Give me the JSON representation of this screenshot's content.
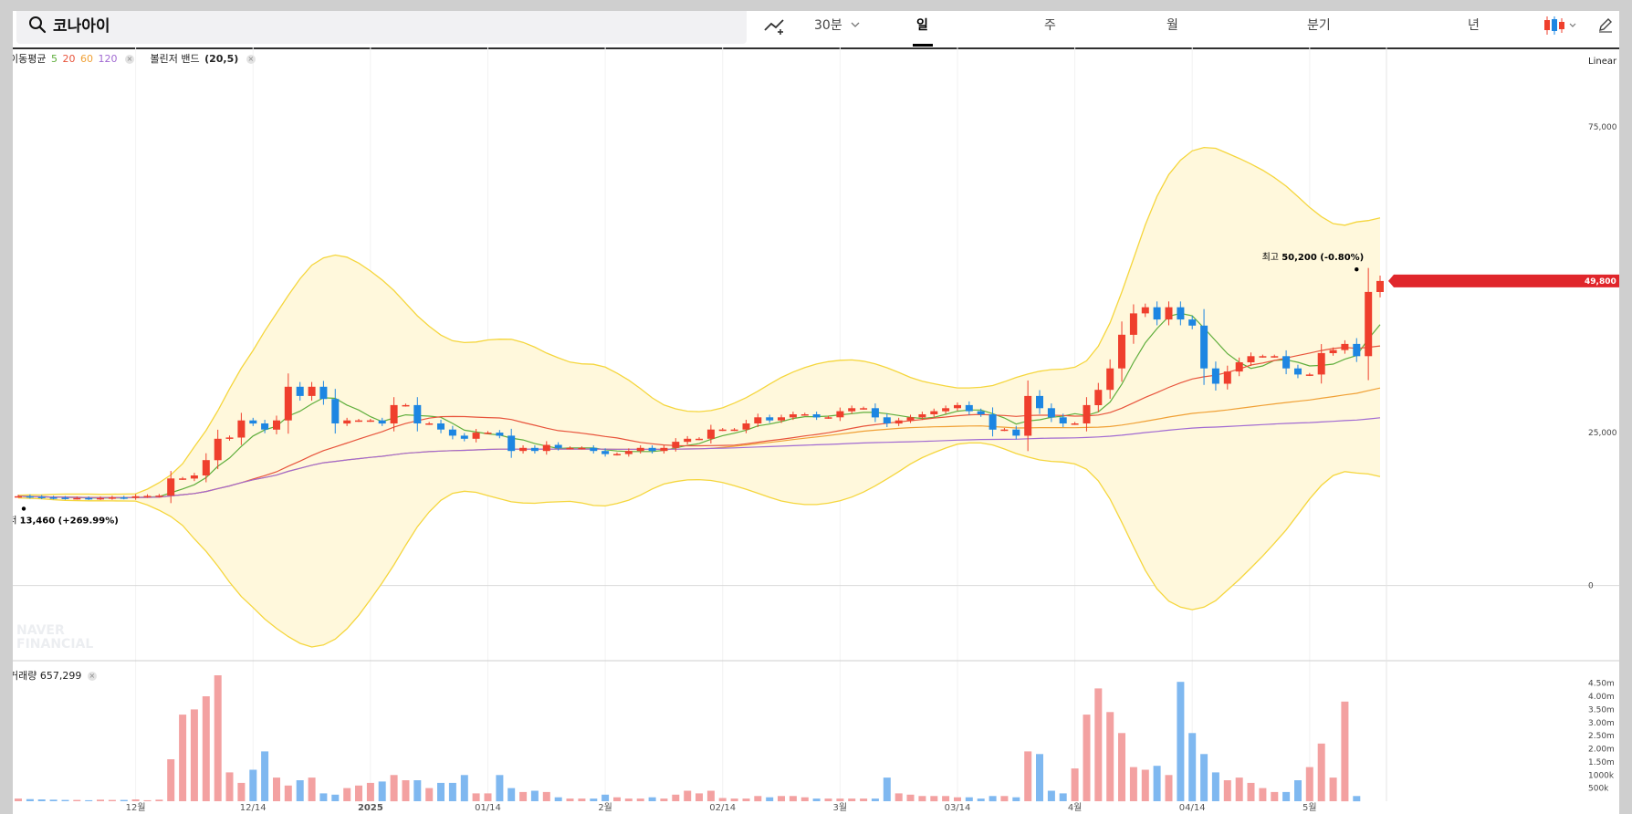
{
  "search": {
    "value": "코나아이",
    "icon": "search-icon"
  },
  "toolbar": {
    "draw_icon": "line-chart-plus-icon",
    "interval": "30분",
    "periods": [
      "일",
      "주",
      "월",
      "분기",
      "년"
    ],
    "active_period": "일",
    "candle_icon": "candlestick-icon",
    "edit_icon": "pencil-icon"
  },
  "indicators": {
    "ma_label": "이동평균",
    "ma_periods": [
      "5",
      "20",
      "60",
      "120"
    ],
    "ma_colors": [
      "#5fae3c",
      "#e8543c",
      "#f0a035",
      "#a16ad2"
    ],
    "bb_label": "볼린저 밴드",
    "bb_params": "(20,5)"
  },
  "scale_label": "Linear",
  "watermark": [
    "NAVER",
    "FINANCIAL"
  ],
  "volume_label": "거래량 657,299",
  "chart_data": {
    "type": "candlestick",
    "y_ticks": [
      "75,000",
      "25,000",
      "0"
    ],
    "y_tick_values": [
      75000,
      25000,
      0
    ],
    "ylim": [
      -12000,
      85000
    ],
    "volume_ticks": [
      "4.50m",
      "4.00m",
      "3.50m",
      "3.00m",
      "2.50m",
      "2.00m",
      "1.50m",
      "1000k",
      "500k"
    ],
    "volume_tick_values": [
      4500000,
      4000000,
      3500000,
      3000000,
      2500000,
      2000000,
      1500000,
      1000000,
      500000
    ],
    "volume_ylim": [
      0,
      4800000
    ],
    "x_labels": [
      "12월",
      "12/14",
      "2025",
      "01/14",
      "2월",
      "02/14",
      "3월",
      "03/14",
      "4월",
      "04/14",
      "5월"
    ],
    "x_label_index": [
      10,
      20,
      30,
      40,
      50,
      60,
      70,
      80,
      90,
      100,
      110
    ],
    "last_price_label": "49,800",
    "last_price": 49800,
    "high_annotation": {
      "prefix": "최고",
      "value": "50,200 (-0.80%)",
      "index": 114,
      "price": 50200
    },
    "low_annotation": {
      "prefix": "최저",
      "value": "13,460 (+269.99%)",
      "index": 0,
      "price": 13460
    },
    "colors": {
      "up": "#ef3f2d",
      "down": "#1d86e2",
      "up_volume": "#f3a1a1",
      "down_volume": "#7fb8f0",
      "band_fill": "#fff8dc",
      "band_line": "#f5d63d"
    },
    "close": [
      14600,
      14500,
      14400,
      14350,
      14300,
      14300,
      14250,
      14300,
      14400,
      14350,
      14600,
      14650,
      14700,
      17500,
      17500,
      18000,
      20500,
      24000,
      24200,
      27000,
      26500,
      25500,
      27000,
      32500,
      31000,
      32500,
      30500,
      26500,
      27000,
      27000,
      27000,
      26500,
      29500,
      29500,
      26500,
      26500,
      25500,
      24500,
      24000,
      25000,
      25000,
      24500,
      22000,
      22500,
      22000,
      23000,
      22500,
      22500,
      22500,
      22000,
      21500,
      21500,
      22000,
      22500,
      22000,
      22500,
      23500,
      24000,
      24000,
      25500,
      25500,
      25500,
      26500,
      27500,
      27000,
      27500,
      28000,
      28000,
      27500,
      27500,
      28500,
      29000,
      29000,
      27500,
      26500,
      27000,
      27500,
      28000,
      28500,
      29000,
      29500,
      28500,
      28000,
      25500,
      25500,
      24500,
      31000,
      29000,
      27500,
      26500,
      26500,
      29500,
      32000,
      35500,
      41000,
      44500,
      45500,
      43500,
      45500,
      43500,
      42500,
      35500,
      33000,
      35000,
      36500,
      37500,
      37500,
      37500,
      35500,
      34500,
      34500,
      38000,
      38500,
      39500,
      37500,
      48000,
      49800
    ],
    "volume": [
      100000,
      80000,
      70000,
      60000,
      50000,
      50000,
      40000,
      60000,
      50000,
      50000,
      70000,
      40000,
      60000,
      1600000,
      3300000,
      3500000,
      4000000,
      4800000,
      1100000,
      700000,
      1200000,
      1900000,
      900000,
      600000,
      800000,
      900000,
      300000,
      250000,
      500000,
      600000,
      700000,
      750000,
      1000000,
      800000,
      800000,
      500000,
      700000,
      700000,
      1000000,
      300000,
      300000,
      1000000,
      500000,
      350000,
      400000,
      350000,
      150000,
      100000,
      100000,
      100000,
      250000,
      150000,
      100000,
      100000,
      150000,
      100000,
      250000,
      400000,
      300000,
      400000,
      120000,
      100000,
      100000,
      200000,
      150000,
      200000,
      200000,
      150000,
      100000,
      100000,
      100000,
      100000,
      100000,
      100000,
      900000,
      300000,
      250000,
      200000,
      200000,
      200000,
      150000,
      150000,
      100000,
      200000,
      200000,
      150000,
      1900000,
      1800000,
      400000,
      300000,
      1250000,
      3300000,
      4300000,
      3400000,
      2600000,
      1300000,
      1200000,
      1350000,
      1000000,
      4550000,
      2600000,
      1800000,
      1100000,
      800000,
      900000,
      700000,
      500000,
      350000,
      350000,
      800000,
      1300000,
      2200000,
      900000,
      3800000,
      200000
    ]
  }
}
